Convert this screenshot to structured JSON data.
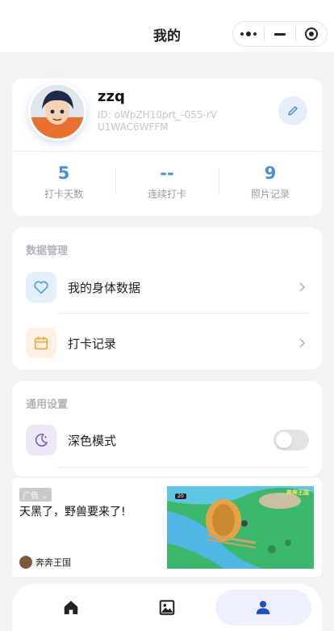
{
  "header": {
    "title": "我的"
  },
  "profile": {
    "name": "zzq",
    "id_text": "ID: oWpZH10prt_-055-rVU1WAC6WFFM",
    "stats": [
      {
        "value": "5",
        "label": "打卡天数"
      },
      {
        "value": "--",
        "label": "连续打卡"
      },
      {
        "value": "9",
        "label": "照片记录"
      }
    ]
  },
  "data_section": {
    "title": "数据管理",
    "items": [
      {
        "label": "我的身体数据",
        "icon": "heart-icon",
        "bg": "#e3f0fc",
        "color": "#4a9fe8"
      },
      {
        "label": "打卡记录",
        "icon": "calendar-icon",
        "bg": "#fdf1e3",
        "color": "#f5a53d"
      }
    ]
  },
  "settings_section": {
    "title": "通用设置",
    "items": [
      {
        "label": "深色模式",
        "icon": "moon-icon",
        "bg": "#ede8f7",
        "color": "#7c5fc4",
        "enabled": false
      }
    ]
  },
  "ad": {
    "tag": "广告",
    "headline": "天黑了，野兽要来了!",
    "brand": "奔奔王国",
    "image_game_label": "奔奔王国",
    "image_score": "20"
  },
  "tabbar": {
    "items": [
      {
        "icon": "home-icon",
        "active": false
      },
      {
        "icon": "image-icon",
        "active": false
      },
      {
        "icon": "user-icon",
        "active": true
      }
    ]
  },
  "colors": {
    "accent": "#4a8fd8",
    "active_tab": "#1e4fc4"
  }
}
